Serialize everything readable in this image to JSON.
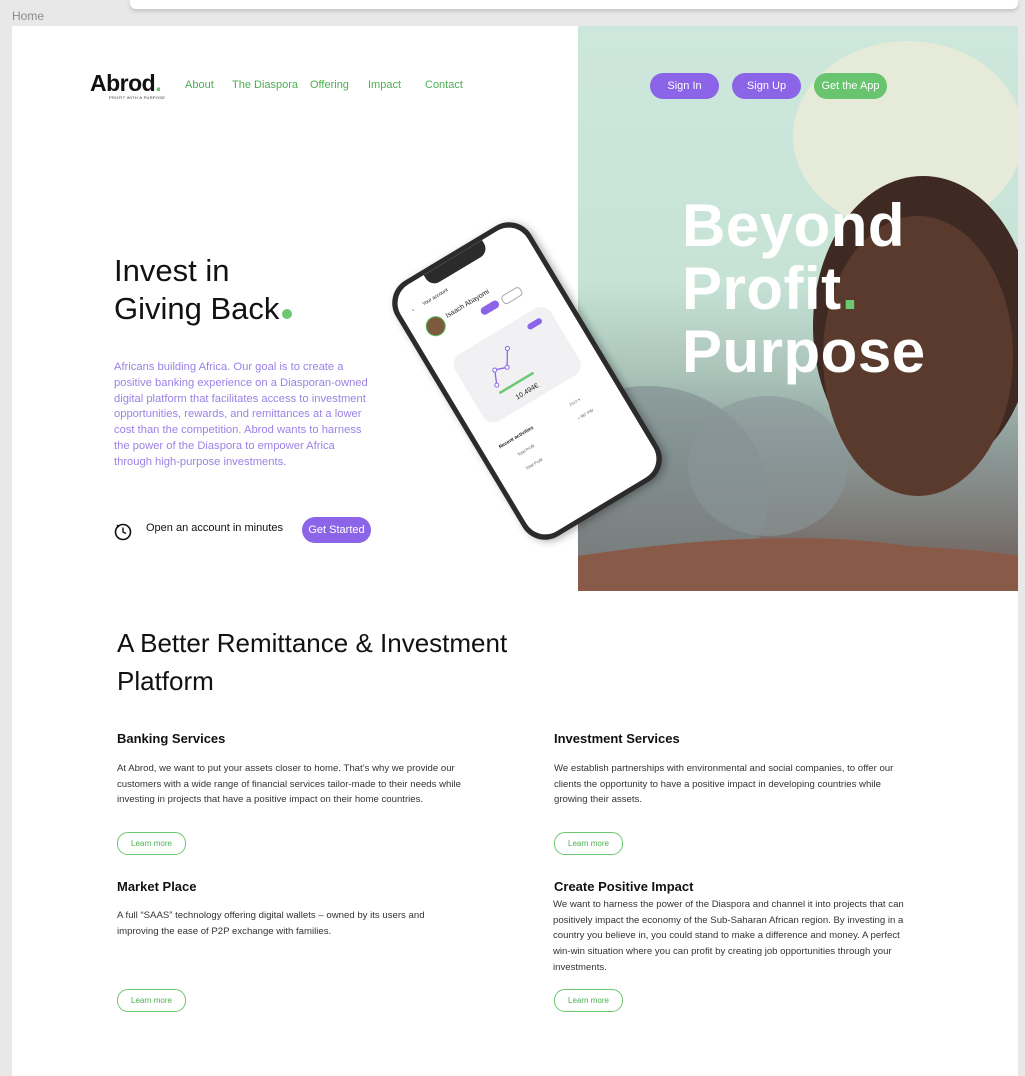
{
  "breadcrumb": "Home",
  "logo": {
    "word": "Abrod",
    "tagline": "PROFIT WITH A PURPOSE"
  },
  "nav": {
    "links": [
      "About",
      "The Diaspora",
      "Offering",
      "Impact",
      "Contact"
    ],
    "sign_in": "Sign In",
    "sign_up": "Sign Up",
    "get_app": "Get the App"
  },
  "hero": {
    "title_line1": "Invest in",
    "title_line2": "Giving Back",
    "description": "Africans building Africa. Our goal is to create a positive banking experience on a Diasporan-owned digital platform that facilitates access to investment opportunities, rewards, and remittances at a lower cost than the competition. Abrod wants to harness the power of the Diaspora to empower Africa through high-purpose investments.",
    "open_account": "Open an account in minutes",
    "cta": "Get Started",
    "headline": [
      "Beyond",
      "Profit",
      "Purpose"
    ]
  },
  "phone": {
    "header": "Your account",
    "user_name": "Isaach Abayomi",
    "balance": "10.494€",
    "recent": "Recent activities",
    "recent_right": "2019 ▾",
    "rows": [
      "Total Profit",
      "Total Profit"
    ],
    "amount": "+ 987 PW"
  },
  "section": {
    "title": "A Better Remittance & Investment Platform",
    "learn_more": "Learn more",
    "services": [
      {
        "title": "Banking Services",
        "text": "At Abrod, we want to put your assets closer to home. That’s why we provide our customers with a wide range of financial services tailor-made to their needs while investing in projects that have a positive impact on their home countries."
      },
      {
        "title": "Investment Services",
        "text": "We establish partnerships with environmental and social companies, to offer our clients the opportunity to have a positive impact in developing countries while growing their assets."
      },
      {
        "title": "Market Place",
        "text": "A full “SAAS” technology offering digital wallets – owned by its users and improving the ease of P2P exchange with families."
      },
      {
        "title": "Create Positive Impact",
        "text": "We want to harness the power of the Diaspora and channel it into projects that can positively impact the economy of the Sub-Saharan African region. By investing in a country you believe in, you could stand to make a difference and money. A perfect win-win situation where you can profit by creating job opportunities through your investments."
      }
    ]
  },
  "colors": {
    "green": "#6cc870",
    "purple": "#8b64e8",
    "lavender_text": "#9b82e6"
  }
}
